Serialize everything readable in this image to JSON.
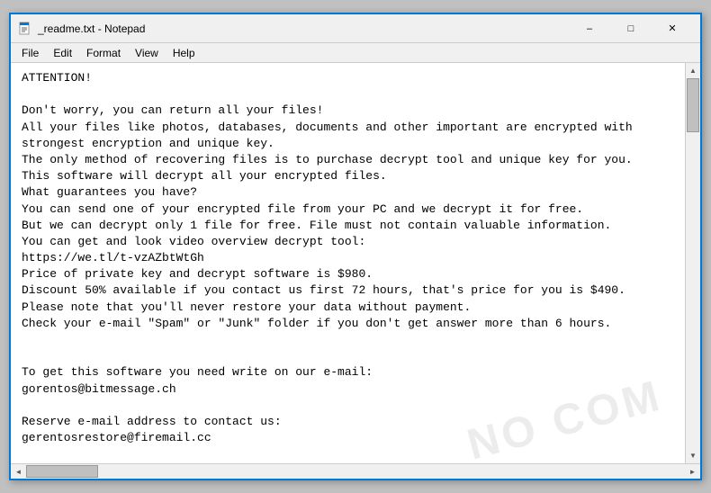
{
  "titleBar": {
    "title": "_readme.txt - Notepad",
    "minimizeLabel": "–",
    "maximizeLabel": "□",
    "closeLabel": "✕"
  },
  "menuBar": {
    "items": [
      "File",
      "Edit",
      "Format",
      "View",
      "Help"
    ]
  },
  "content": {
    "text": "ATTENTION!\n\nDon't worry, you can return all your files!\nAll your files like photos, databases, documents and other important are encrypted with\nstrongest encryption and unique key.\nThe only method of recovering files is to purchase decrypt tool and unique key for you.\nThis software will decrypt all your encrypted files.\nWhat guarantees you have?\nYou can send one of your encrypted file from your PC and we decrypt it for free.\nBut we can decrypt only 1 file for free. File must not contain valuable information.\nYou can get and look video overview decrypt tool:\nhttps://we.tl/t-vzAZbtWtGh\nPrice of private key and decrypt software is $980.\nDiscount 50% available if you contact us first 72 hours, that's price for you is $490.\nPlease note that you'll never restore your data without payment.\nCheck your e-mail \"Spam\" or \"Junk\" folder if you don't get answer more than 6 hours.\n\n\nTo get this software you need write on our e-mail:\ngorentos@bitmessage.ch\n\nReserve e-mail address to contact us:\ngerentosrestore@firemail.cc\n\nYour personal ID:\n-"
  },
  "watermark": "NO COM",
  "statusBar": {
    "text": ""
  }
}
